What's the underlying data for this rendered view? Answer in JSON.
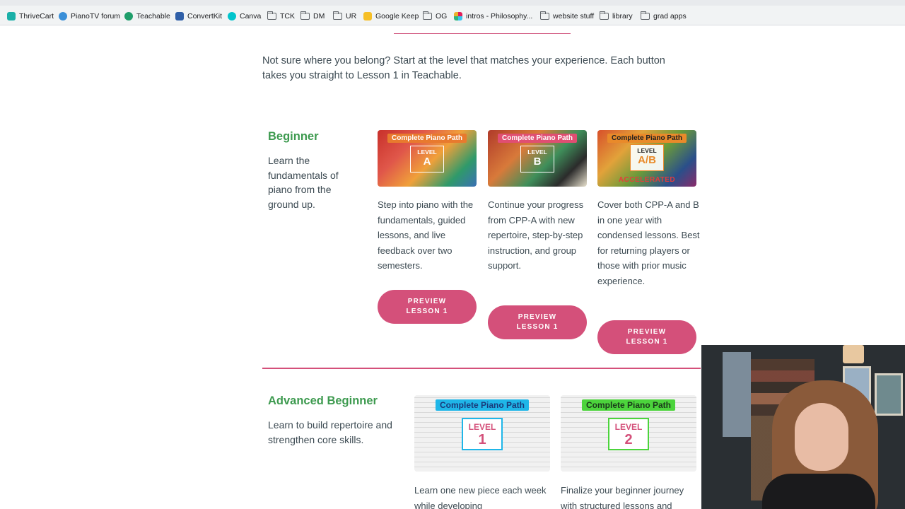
{
  "bookmarks_bar": {
    "items": [
      {
        "label": "ThriveCart",
        "icon": "thrivecart-icon",
        "color": "#1ab0a8"
      },
      {
        "label": "PianoTV forum",
        "icon": "pianotv-icon",
        "color": "#3a8fd8"
      },
      {
        "label": "Teachable",
        "icon": "teachable-icon",
        "color": "#1f9e6b"
      },
      {
        "label": "ConvertKit",
        "icon": "convertkit-icon",
        "color": "#2f5fa8"
      },
      {
        "label": "Canva",
        "icon": "canva-icon",
        "color": "#00c4cc"
      },
      {
        "label": "TCK",
        "icon": "folder-icon"
      },
      {
        "label": "DM",
        "icon": "folder-icon"
      },
      {
        "label": "UR",
        "icon": "folder-icon"
      },
      {
        "label": "Google Keep",
        "icon": "google-keep-icon",
        "color": "#f6bf26"
      },
      {
        "label": "OG",
        "icon": "folder-icon"
      },
      {
        "label": "intros - Philosophy...",
        "icon": "slack-icon",
        "color": "#e01e5a"
      },
      {
        "label": "website stuff",
        "icon": "folder-icon"
      },
      {
        "label": "library",
        "icon": "folder-icon"
      },
      {
        "label": "grad apps",
        "icon": "folder-icon"
      }
    ]
  },
  "page": {
    "intro": "Not sure where you belong? Start at the level that matches your experience. Each button takes you straight to Lesson 1 in Teachable.",
    "accent_color": "#d4507a",
    "heading_color": "#3d9a4f"
  },
  "beginner": {
    "title": "Beginner",
    "description": "Learn the fundamentals of piano from the ground up.",
    "cards": [
      {
        "thumb_banner": "Complete Piano Path",
        "thumb_word": "LEVEL",
        "thumb_level": "A",
        "thumb_extra": "",
        "text": "Step into piano with the fundamentals, guided lessons, and live feedback over two semesters.",
        "button": "PREVIEW LESSON 1"
      },
      {
        "thumb_banner": "Complete Piano Path",
        "thumb_word": "LEVEL",
        "thumb_level": "B",
        "thumb_extra": "",
        "text": "Continue your progress from CPP-A with new repertoire, step-by-step instruction, and group support.",
        "button": "PREVIEW LESSON 1"
      },
      {
        "thumb_banner": "Complete Piano Path",
        "thumb_word": "LEVEL",
        "thumb_level": "A/B",
        "thumb_extra": "ACCELERATED",
        "text": "Cover both CPP-A and B in one year with condensed lessons. Best for returning players or those with prior music experience.",
        "button": "PREVIEW LESSON 1"
      }
    ]
  },
  "advanced_beginner": {
    "title": "Advanced Beginner",
    "description": "Learn to build repertoire and strengthen core skills.",
    "cards": [
      {
        "thumb_banner": "Complete Piano Path",
        "thumb_word": "LEVEL",
        "thumb_level": "1",
        "banner_color": "#1fb6e8",
        "text": "Learn one new piece each week while developing"
      },
      {
        "thumb_banner": "Complete Piano Path",
        "thumb_word": "LEVEL",
        "thumb_level": "2",
        "banner_color": "#4cd43c",
        "text": "Finalize your beginner journey with structured lessons and"
      }
    ]
  }
}
